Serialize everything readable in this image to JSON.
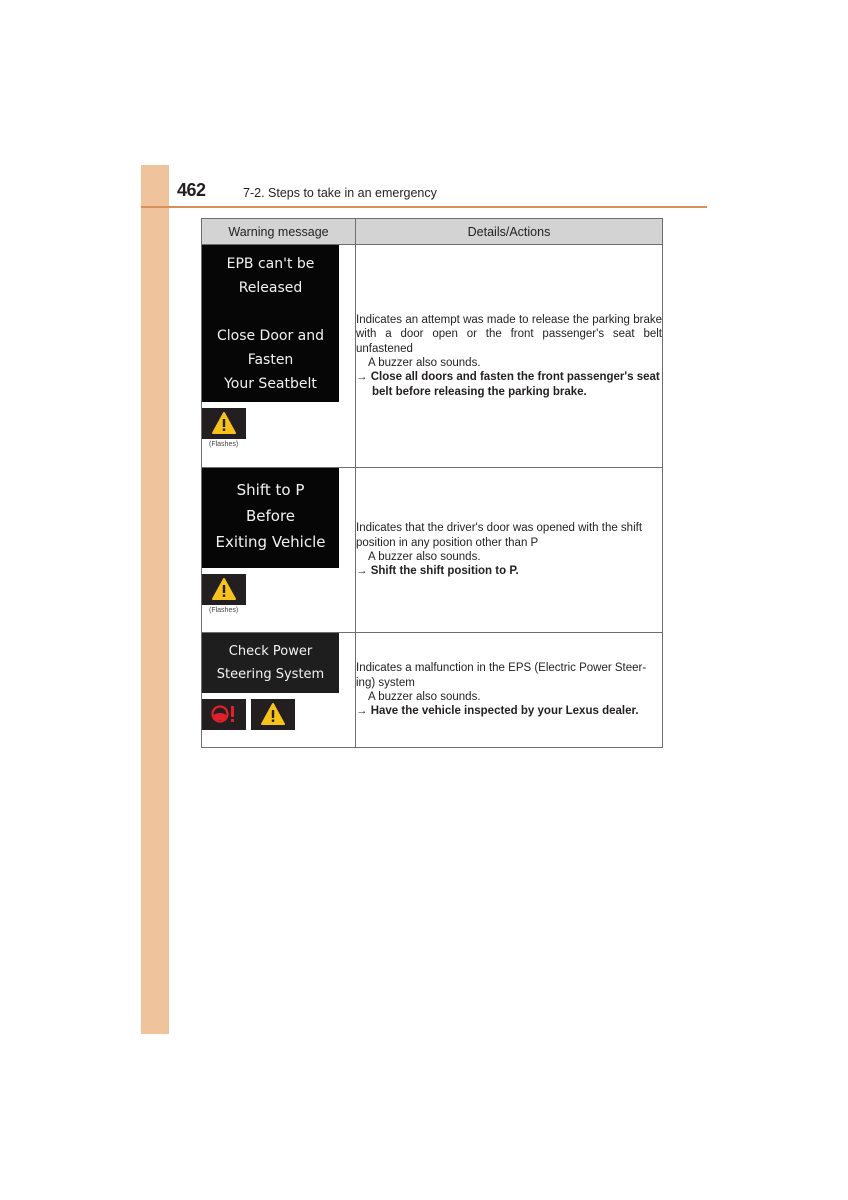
{
  "header": {
    "page_number": "462",
    "section_title": "7-2. Steps to take in an emergency"
  },
  "table": {
    "columns": [
      "Warning message",
      "Details/Actions"
    ],
    "rows": [
      {
        "screen_lines": [
          "EPB can't be",
          "Released",
          "",
          "Close Door and",
          "Fasten",
          "Your Seatbelt"
        ],
        "icons": [
          "warning-triangle-icon"
        ],
        "icon_note": "(Flashes)",
        "description": "Indicates an attempt was made to release the parking brake with a door open or the front passenger's seat belt unfastened",
        "buzzer": "A buzzer also sounds.",
        "arrow": "→",
        "action": "Close all doors and fasten the front passenger's seat belt before releasing the parking brake."
      },
      {
        "screen_lines": [
          "Shift to P",
          "Before",
          "Exiting Vehicle"
        ],
        "icons": [
          "warning-triangle-icon"
        ],
        "icon_note": "(Flashes)",
        "description": "Indicates that the driver's door was opened with the shift position in any position other than P",
        "buzzer": "A buzzer also sounds.",
        "arrow": "→",
        "action": "Shift the shift position to P."
      },
      {
        "screen_lines": [
          "Check Power",
          "Steering System"
        ],
        "icons": [
          "power-steering-warning-icon",
          "warning-triangle-icon"
        ],
        "icon_note": "",
        "description": "Indicates a malfunction in the EPS (Electric Power Steer-ing) system",
        "buzzer": "A buzzer also sounds.",
        "arrow": "→",
        "action": "Have the vehicle inspected by your Lexus dealer."
      }
    ]
  },
  "colors": {
    "side_tab": "#efc39c",
    "rule": "#d78f59",
    "header_bg": "#d3d3d3",
    "warning_yellow": "#f7c21a",
    "warning_red": "#e0212b"
  }
}
